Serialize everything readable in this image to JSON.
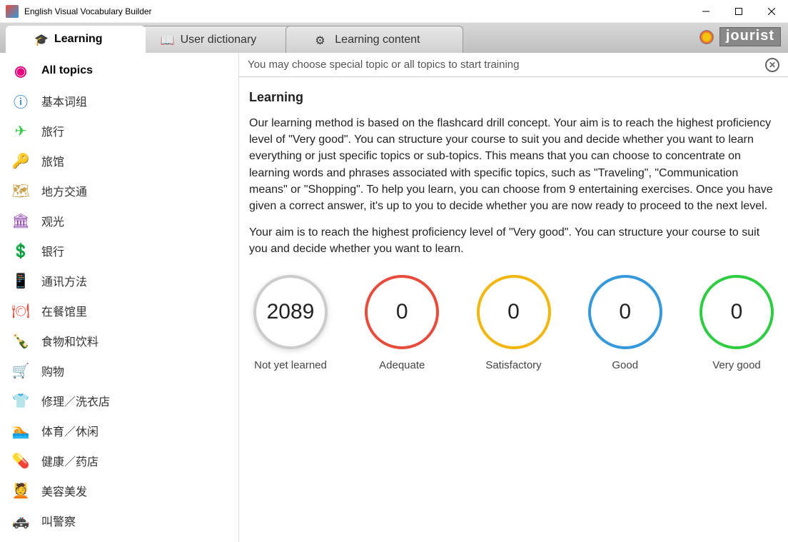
{
  "window": {
    "title": "English Visual Vocabulary Builder"
  },
  "tabs": {
    "learning": "Learning",
    "dictionary": "User dictionary",
    "content": "Learning content"
  },
  "brand": "jourist",
  "sidebar": {
    "items": [
      {
        "label": "All topics",
        "color": "#e6007e"
      },
      {
        "label": "基本词组",
        "color": "#0066cc"
      },
      {
        "label": "旅行",
        "color": "#2ecc40"
      },
      {
        "label": "旅馆",
        "color": "#c0392b"
      },
      {
        "label": "地方交通",
        "color": "#c9a04a"
      },
      {
        "label": "观光",
        "color": "#8e44ad"
      },
      {
        "label": "银行",
        "color": "#16a085"
      },
      {
        "label": "通讯方法",
        "color": "#e67e22"
      },
      {
        "label": "在餐馆里",
        "color": "#e74c3c"
      },
      {
        "label": "食物和饮料",
        "color": "#27ae60"
      },
      {
        "label": "购物",
        "color": "#7f8c8d"
      },
      {
        "label": "修理／洗衣店",
        "color": "#2980b9"
      },
      {
        "label": "体育／休闲",
        "color": "#16a085"
      },
      {
        "label": "健康／药店",
        "color": "#7f8c8d"
      },
      {
        "label": "美容美发",
        "color": "#e6007e"
      },
      {
        "label": "叫警察",
        "color": "#2c3e50"
      }
    ]
  },
  "notice": "You may choose special topic or all topics to start training",
  "main": {
    "heading": "Learning",
    "p1": "Our learning method is based on the flashcard drill concept. Your aim is to reach the highest proficiency level of \"Very good\". You can structure your course to suit you and decide whether you want to learn everything or just specific topics or sub-topics. This means that you can choose to concentrate on learning words and phrases associated with specific topics, such as \"Traveling\", \"Communication means\" or \"Shopping\". To help you learn, you can choose from 9 entertaining exercises. Once you have given a correct answer, it's up to you to decide whether you are now ready to proceed to the next level.",
    "p2": "Your aim is to reach the highest proficiency level of \"Very good\". You can structure your course to suit you and decide whether you want to learn."
  },
  "stats": [
    {
      "value": "2089",
      "label": "Not yet learned",
      "color": "#cccccc"
    },
    {
      "value": "0",
      "label": "Adequate",
      "color": "#e74c3c"
    },
    {
      "value": "0",
      "label": "Satisfactory",
      "color": "#f1b70e"
    },
    {
      "value": "0",
      "label": "Good",
      "color": "#3498db"
    },
    {
      "value": "0",
      "label": "Very good",
      "color": "#2ecc40"
    }
  ],
  "icons": [
    "◉",
    "ⓘ",
    "✈",
    "🔑",
    "🗺",
    "🏛",
    "💲",
    "📱",
    "🍽",
    "🍾",
    "🛒",
    "👕",
    "🏊",
    "💊",
    "💆",
    "🚓"
  ]
}
